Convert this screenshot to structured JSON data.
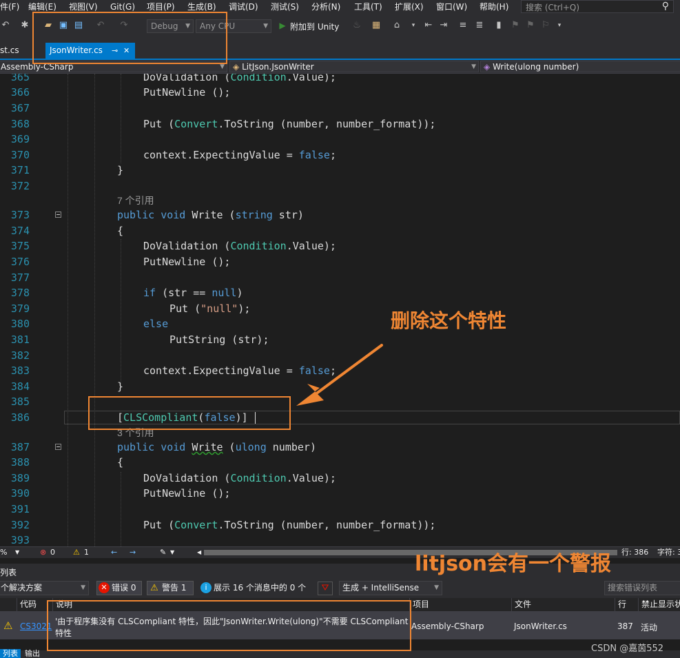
{
  "menu": [
    "件(F)",
    "编辑(E)",
    "视图(V)",
    "Git(G)",
    "项目(P)",
    "生成(B)",
    "调试(D)",
    "测试(S)",
    "分析(N)",
    "工具(T)",
    "扩展(X)",
    "窗口(W)",
    "帮助(H)"
  ],
  "search": {
    "placeholder": "搜索 (Ctrl+Q)"
  },
  "toolbar": {
    "config": "Debug",
    "platform": "Any CPU",
    "attach": "附加到 Unity"
  },
  "tabs": {
    "prev_tab": "st.cs",
    "active_tab": "JsonWriter.cs",
    "pin": "⊸",
    "close": "✕"
  },
  "navbar": {
    "project": "Assembly-CSharp",
    "class": "LitJson.JsonWriter",
    "member": "Write(ulong number)"
  },
  "code": {
    "l365": "365",
    "l366": "366",
    "l367": "367",
    "l368": "368",
    "l369": "369",
    "l370": "370",
    "l371": "371",
    "l372": "372",
    "l373": "373",
    "l374": "374",
    "l375": "375",
    "l376": "376",
    "l377": "377",
    "l378": "378",
    "l379": "379",
    "l380": "380",
    "l381": "381",
    "l382": "382",
    "l383": "383",
    "l384": "384",
    "l385": "385",
    "l386": "386",
    "l387": "387",
    "l388": "388",
    "l389": "389",
    "l390": "390",
    "l391": "391",
    "l392": "392",
    "l393": "393",
    "refs7": "7 个引用",
    "refs3": "3 个引用",
    "kw_public": "public",
    "kw_void": "void",
    "fn_write": "Write",
    "kw_string": "string",
    "kw_ulong": "ulong",
    "kw_if": "if",
    "kw_null": "null",
    "kw_else": "else",
    "kw_false": "false",
    "t_convert": "Convert",
    "t_condition": "Condition",
    "t_clscompliant": "CLSCompliant",
    "str_null": "\"null\""
  },
  "status": {
    "zoom": "% ",
    "errors": "0",
    "warnings": "1",
    "position": "行: 386",
    "column": "字符: 3"
  },
  "errorlist": {
    "title": "列表",
    "scope": "个解决方案",
    "errors_btn": "错误 0",
    "warnings_btn": "警告 1",
    "messages_btn": "展示 16 个消息中的 0 个",
    "build_filter": "生成 + IntelliSense",
    "search_placeholder": "搜索错误列表",
    "cols": {
      "code": "代码",
      "desc": "说明",
      "project": "项目",
      "file": "文件",
      "line": "行",
      "suppress": "禁止显示状"
    },
    "row": {
      "code": "CS3021",
      "desc1": "'由于程序集没有 CLSCompliant 特性，因此\"JsonWriter.Write(ulong)\"不需要 CLSCompliant",
      "desc2": "特性",
      "project": "Assembly-CSharp",
      "file": "JsonWriter.cs",
      "line": "387",
      "state": "活动"
    },
    "bottom_tab1": "列表",
    "bottom_tab2": "输出"
  },
  "annotations": {
    "delete_hint": "删除这个特性",
    "warning_hint": "litjson会有一个警报"
  },
  "watermark": "CSDN @嘉茵552",
  "colors": {
    "accent": "#007acc",
    "annotation": "#ef8633"
  }
}
